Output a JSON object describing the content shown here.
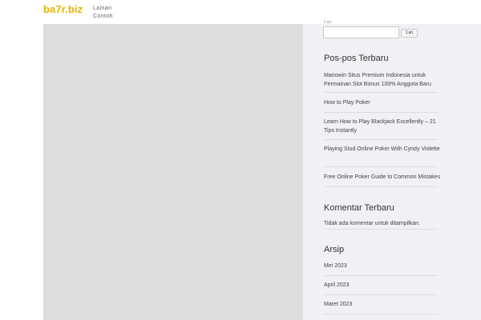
{
  "site": {
    "title": "ba7r.biz"
  },
  "nav": {
    "items": [
      {
        "label": "Laman Contoh"
      }
    ]
  },
  "search": {
    "label": "Cari:",
    "value": "",
    "button_label": "Cari"
  },
  "recent_posts": {
    "title": "Pos-pos Terbaru",
    "items": [
      {
        "label": "Mariowin Situs Premium Indonesia untuk Permainan Slot Bonus 100% Anggota Baru"
      },
      {
        "label": "How to Play Poker"
      },
      {
        "label": "Learn How to Play Blackjack Excellently – 21 Tips Instantly"
      },
      {
        "label": "Playing Stud Online Poker With Cyndy Violette"
      },
      {
        "label": "Free Online Poker Guide to Common Mistakes"
      }
    ]
  },
  "recent_comments": {
    "title": "Komentar Terbaru",
    "empty_text": "Tidak ada komentar untuk ditampilkan."
  },
  "archives": {
    "title": "Arsip",
    "items": [
      {
        "label": "Mei 2023"
      },
      {
        "label": "April 2023"
      },
      {
        "label": "Maret 2023"
      }
    ]
  },
  "colors": {
    "brand": "#e3b500",
    "content_placeholder": "#dddddd",
    "sidebar_background": "#f1f1f5"
  }
}
